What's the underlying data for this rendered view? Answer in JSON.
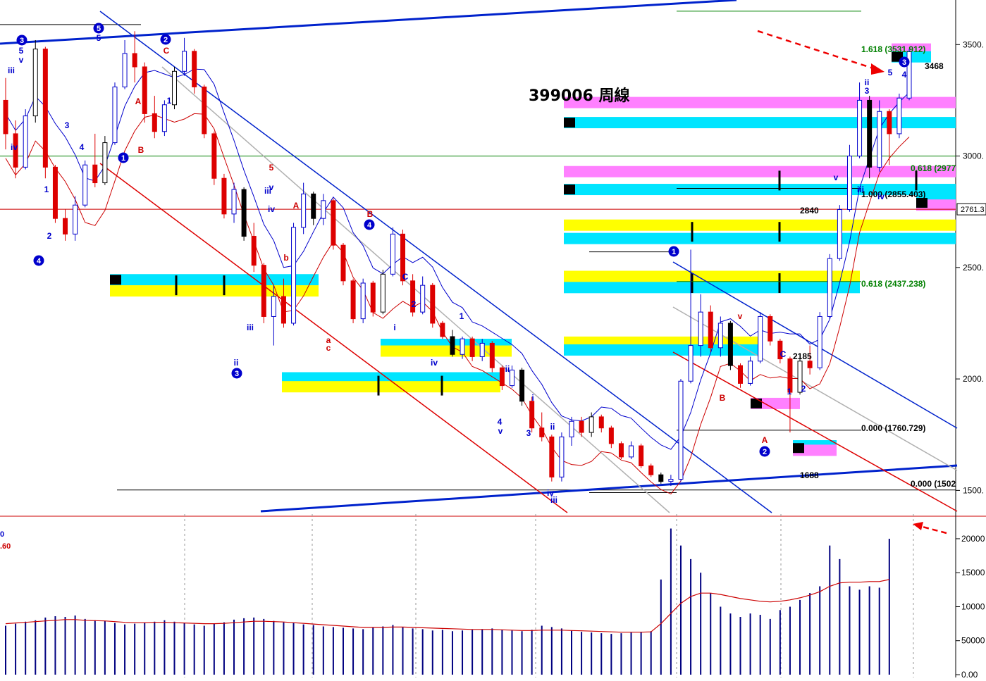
{
  "title": "399006 周線",
  "price_axis": {
    "range": [
      1400,
      3700
    ],
    "ticks": [
      {
        "label": "3500.",
        "value": 3500
      },
      {
        "label": "3000.",
        "value": 3000
      },
      {
        "label": "2500.",
        "value": 2500
      },
      {
        "label": "2000.",
        "value": 2000
      },
      {
        "label": "1500.",
        "value": 1500
      }
    ],
    "current_price_label": "2761.3",
    "current_price_value": 2761.3
  },
  "volume_axis": {
    "range": [
      0,
      23000
    ],
    "ticks": [
      {
        "label": "20000",
        "value": 20000
      },
      {
        "label": "15000",
        "value": 15000
      },
      {
        "label": "10000",
        "value": 10000
      },
      {
        "label": "50000",
        "value": 5000
      },
      {
        "label": "0.00",
        "value": 0
      }
    ],
    "left_labels": [
      "0",
      ".60"
    ]
  },
  "fib_levels": [
    {
      "label": "1.618 (3531.912)",
      "value": 3531.912,
      "color": "#008000"
    },
    {
      "label": "0.618 (2977",
      "value": 2977,
      "color": "#008000"
    },
    {
      "label": "1.000 (2855.403)",
      "value": 2855.403,
      "color": "#000000"
    },
    {
      "label": "0.618 (2437.238)",
      "value": 2437.238,
      "color": "#008000"
    },
    {
      "label": "0.000 (1760.729)",
      "value": 1760.729,
      "color": "#000000"
    },
    {
      "label": "0.000 (1502",
      "value": 1502,
      "color": "#000000"
    }
  ],
  "price_notes": [
    {
      "text": "3468",
      "value": 3468
    },
    {
      "text": "2840",
      "value": 2840
    },
    {
      "text": "2185",
      "value": 2185
    },
    {
      "text": "1688",
      "value": 1688
    }
  ],
  "wave_labels_circled": [
    "3",
    "5",
    "2",
    "1",
    "4",
    "4",
    "3",
    "1",
    "2",
    "3"
  ],
  "wave_labels": [
    "5",
    "v",
    "iii",
    "iv",
    "5",
    "C",
    "1",
    "A",
    "B",
    "1",
    "2",
    "3",
    "4",
    "iii",
    "v",
    "iv",
    "ii",
    "5",
    "A",
    "b",
    "a",
    "c",
    "B",
    "C",
    "2",
    "i",
    "1",
    "iv",
    "iii",
    "ii",
    "4",
    "v",
    "3",
    "i",
    "ii",
    "iv",
    "iii",
    "v",
    "B",
    "A",
    "C",
    "1",
    "2",
    "ii",
    "3",
    "v",
    "iii",
    "iv",
    "4",
    "5",
    "i"
  ],
  "colors": {
    "up_candle": "#0000cc",
    "down_candle": "#dd0000",
    "neutral_candle": "#000000",
    "channel_blue": "#0022cc",
    "channel_red": "#dd0000",
    "band_cyan": "#00e5ff",
    "band_yellow": "#ffff00",
    "band_magenta": "#ff80ff",
    "volume_bar": "#000080",
    "volume_ma": "#cc0000"
  },
  "chart_data": {
    "type": "candlestick",
    "period": "weekly",
    "price_series": [
      {
        "o": 3250,
        "h": 3350,
        "l": 3030,
        "c": 3100
      },
      {
        "o": 3100,
        "h": 3160,
        "l": 2900,
        "c": 2950
      },
      {
        "o": 2950,
        "h": 3210,
        "l": 2940,
        "c": 3180
      },
      {
        "o": 3180,
        "h": 3520,
        "l": 3150,
        "c": 3480
      },
      {
        "o": 3480,
        "h": 3490,
        "l": 2900,
        "c": 2950
      },
      {
        "o": 2950,
        "h": 2960,
        "l": 2700,
        "c": 2720
      },
      {
        "o": 2720,
        "h": 2760,
        "l": 2620,
        "c": 2650
      },
      {
        "o": 2650,
        "h": 2820,
        "l": 2620,
        "c": 2780
      },
      {
        "o": 2780,
        "h": 2980,
        "l": 2770,
        "c": 2960
      },
      {
        "o": 2960,
        "h": 3100,
        "l": 2860,
        "c": 2880
      },
      {
        "o": 2880,
        "h": 3090,
        "l": 2870,
        "c": 3060
      },
      {
        "o": 3060,
        "h": 3330,
        "l": 3050,
        "c": 3310
      },
      {
        "o": 3310,
        "h": 3520,
        "l": 3300,
        "c": 3460
      },
      {
        "o": 3460,
        "h": 3560,
        "l": 3330,
        "c": 3400
      },
      {
        "o": 3400,
        "h": 3420,
        "l": 3150,
        "c": 3190
      },
      {
        "o": 3190,
        "h": 3270,
        "l": 3080,
        "c": 3110
      },
      {
        "o": 3110,
        "h": 3250,
        "l": 3090,
        "c": 3230
      },
      {
        "o": 3230,
        "h": 3400,
        "l": 3210,
        "c": 3380
      },
      {
        "o": 3380,
        "h": 3530,
        "l": 3360,
        "c": 3470
      },
      {
        "o": 3470,
        "h": 3480,
        "l": 3280,
        "c": 3310
      },
      {
        "o": 3310,
        "h": 3320,
        "l": 3080,
        "c": 3100
      },
      {
        "o": 3100,
        "h": 3110,
        "l": 2870,
        "c": 2900
      },
      {
        "o": 2900,
        "h": 2920,
        "l": 2720,
        "c": 2740
      },
      {
        "o": 2740,
        "h": 2880,
        "l": 2700,
        "c": 2850
      },
      {
        "o": 2850,
        "h": 2860,
        "l": 2620,
        "c": 2640
      },
      {
        "o": 2640,
        "h": 2700,
        "l": 2480,
        "c": 2510
      },
      {
        "o": 2510,
        "h": 2520,
        "l": 2250,
        "c": 2280
      },
      {
        "o": 2280,
        "h": 2420,
        "l": 2150,
        "c": 2370
      },
      {
        "o": 2370,
        "h": 2450,
        "l": 2230,
        "c": 2250
      },
      {
        "o": 2250,
        "h": 2700,
        "l": 2240,
        "c": 2680
      },
      {
        "o": 2680,
        "h": 2880,
        "l": 2650,
        "c": 2830
      },
      {
        "o": 2830,
        "h": 2840,
        "l": 2690,
        "c": 2720
      },
      {
        "o": 2720,
        "h": 2830,
        "l": 2690,
        "c": 2800
      },
      {
        "o": 2800,
        "h": 2810,
        "l": 2580,
        "c": 2600
      },
      {
        "o": 2600,
        "h": 2610,
        "l": 2420,
        "c": 2440
      },
      {
        "o": 2440,
        "h": 2450,
        "l": 2250,
        "c": 2270
      },
      {
        "o": 2270,
        "h": 2450,
        "l": 2250,
        "c": 2430
      },
      {
        "o": 2430,
        "h": 2440,
        "l": 2280,
        "c": 2300
      },
      {
        "o": 2300,
        "h": 2490,
        "l": 2290,
        "c": 2470
      },
      {
        "o": 2470,
        "h": 2680,
        "l": 2460,
        "c": 2650
      },
      {
        "o": 2650,
        "h": 2670,
        "l": 2420,
        "c": 2440
      },
      {
        "o": 2440,
        "h": 2470,
        "l": 2280,
        "c": 2300
      },
      {
        "o": 2300,
        "h": 2460,
        "l": 2290,
        "c": 2420
      },
      {
        "o": 2420,
        "h": 2430,
        "l": 2230,
        "c": 2250
      },
      {
        "o": 2250,
        "h": 2260,
        "l": 2180,
        "c": 2190
      },
      {
        "o": 2190,
        "h": 2220,
        "l": 2100,
        "c": 2110
      },
      {
        "o": 2110,
        "h": 2190,
        "l": 2090,
        "c": 2180
      },
      {
        "o": 2180,
        "h": 2190,
        "l": 2080,
        "c": 2100
      },
      {
        "o": 2100,
        "h": 2180,
        "l": 2080,
        "c": 2160
      },
      {
        "o": 2160,
        "h": 2170,
        "l": 2030,
        "c": 2050
      },
      {
        "o": 2050,
        "h": 2060,
        "l": 1950,
        "c": 1970
      },
      {
        "o": 1970,
        "h": 2060,
        "l": 1960,
        "c": 2040
      },
      {
        "o": 2040,
        "h": 2050,
        "l": 1880,
        "c": 1900
      },
      {
        "o": 1900,
        "h": 1920,
        "l": 1760,
        "c": 1780
      },
      {
        "o": 1780,
        "h": 1850,
        "l": 1720,
        "c": 1740
      },
      {
        "o": 1740,
        "h": 1750,
        "l": 1540,
        "c": 1560
      },
      {
        "o": 1560,
        "h": 1760,
        "l": 1540,
        "c": 1740
      },
      {
        "o": 1740,
        "h": 1830,
        "l": 1700,
        "c": 1810
      },
      {
        "o": 1810,
        "h": 1830,
        "l": 1740,
        "c": 1760
      },
      {
        "o": 1760,
        "h": 1850,
        "l": 1740,
        "c": 1830
      },
      {
        "o": 1830,
        "h": 1840,
        "l": 1760,
        "c": 1780
      },
      {
        "o": 1780,
        "h": 1790,
        "l": 1690,
        "c": 1710
      },
      {
        "o": 1710,
        "h": 1720,
        "l": 1640,
        "c": 1650
      },
      {
        "o": 1650,
        "h": 1720,
        "l": 1640,
        "c": 1700
      },
      {
        "o": 1700,
        "h": 1710,
        "l": 1600,
        "c": 1610
      },
      {
        "o": 1610,
        "h": 1620,
        "l": 1560,
        "c": 1570
      },
      {
        "o": 1570,
        "h": 1580,
        "l": 1530,
        "c": 1540
      },
      {
        "o": 1540,
        "h": 1570,
        "l": 1520,
        "c": 1550
      },
      {
        "o": 1550,
        "h": 2000,
        "l": 1540,
        "c": 1990
      },
      {
        "o": 1990,
        "h": 2580,
        "l": 1980,
        "c": 2150
      },
      {
        "o": 2150,
        "h": 2380,
        "l": 2100,
        "c": 2300
      },
      {
        "o": 2300,
        "h": 2330,
        "l": 2120,
        "c": 2140
      },
      {
        "o": 2140,
        "h": 2280,
        "l": 2100,
        "c": 2250
      },
      {
        "o": 2250,
        "h": 2260,
        "l": 2040,
        "c": 2060
      },
      {
        "o": 2060,
        "h": 2070,
        "l": 1960,
        "c": 1980
      },
      {
        "o": 1980,
        "h": 2100,
        "l": 1970,
        "c": 2080
      },
      {
        "o": 2080,
        "h": 2300,
        "l": 2070,
        "c": 2280
      },
      {
        "o": 2280,
        "h": 2290,
        "l": 2150,
        "c": 2170
      },
      {
        "o": 2170,
        "h": 2180,
        "l": 2070,
        "c": 2090
      },
      {
        "o": 2090,
        "h": 2100,
        "l": 1760,
        "c": 1940
      },
      {
        "o": 1940,
        "h": 2100,
        "l": 1930,
        "c": 2080
      },
      {
        "o": 2080,
        "h": 2150,
        "l": 2020,
        "c": 2050
      },
      {
        "o": 2050,
        "h": 2300,
        "l": 2040,
        "c": 2280
      },
      {
        "o": 2280,
        "h": 2560,
        "l": 2270,
        "c": 2540
      },
      {
        "o": 2540,
        "h": 2780,
        "l": 2530,
        "c": 2760
      },
      {
        "o": 2760,
        "h": 3050,
        "l": 2750,
        "c": 3000
      },
      {
        "o": 3000,
        "h": 3330,
        "l": 2990,
        "c": 3250
      },
      {
        "o": 3250,
        "h": 3270,
        "l": 2900,
        "c": 2950
      },
      {
        "o": 2950,
        "h": 3250,
        "l": 2930,
        "c": 3200
      },
      {
        "o": 3200,
        "h": 3210,
        "l": 2960,
        "c": 3100
      },
      {
        "o": 3100,
        "h": 3280,
        "l": 3080,
        "c": 3260
      },
      {
        "o": 3260,
        "h": 3480,
        "l": 3250,
        "c": 3468
      }
    ],
    "volume_series": [
      7200,
      7500,
      7800,
      8000,
      8400,
      8600,
      8500,
      8700,
      8200,
      8000,
      7900,
      7600,
      7400,
      7500,
      7600,
      7800,
      8000,
      7800,
      7600,
      7400,
      7200,
      7500,
      7700,
      8100,
      8300,
      8400,
      8200,
      7900,
      7700,
      7600,
      7400,
      7300,
      7100,
      7000,
      6900,
      6800,
      6700,
      6900,
      7100,
      7300,
      7000,
      6800,
      6700,
      6500,
      6600,
      6400,
      6500,
      6600,
      6700,
      6800,
      6600,
      6500,
      6400,
      6600,
      7200,
      7000,
      6800,
      6500,
      6300,
      6200,
      6100,
      6000,
      6100,
      6200,
      6300,
      6400,
      14000,
      21500,
      19000,
      17000,
      15000,
      12000,
      10000,
      9000,
      8500,
      9000,
      8800,
      8200,
      9500,
      10000,
      11000,
      12000,
      13000,
      19000,
      17000,
      13000,
      12500,
      13000,
      12800,
      20000
    ],
    "volume_ma": [
      7500,
      7600,
      7700,
      7800,
      7900,
      8000,
      8100,
      8100,
      8000,
      7950,
      7900,
      7800,
      7700,
      7650,
      7650,
      7700,
      7700,
      7650,
      7600,
      7550,
      7500,
      7500,
      7550,
      7650,
      7750,
      7850,
      7850,
      7800,
      7750,
      7650,
      7550,
      7450,
      7350,
      7250,
      7150,
      7050,
      6950,
      6950,
      6950,
      7000,
      7000,
      6950,
      6900,
      6850,
      6800,
      6750,
      6700,
      6650,
      6650,
      6650,
      6600,
      6550,
      6500,
      6500,
      6550,
      6550,
      6550,
      6500,
      6450,
      6400,
      6350,
      6300,
      6250,
      6250,
      6250,
      6300,
      7500,
      9000,
      10500,
      11500,
      12000,
      12000,
      11800,
      11500,
      11200,
      11000,
      10800,
      10700,
      10800,
      11000,
      11300,
      11700,
      12200,
      13000,
      13500,
      13600,
      13600,
      13700,
      13700,
      14000
    ]
  }
}
